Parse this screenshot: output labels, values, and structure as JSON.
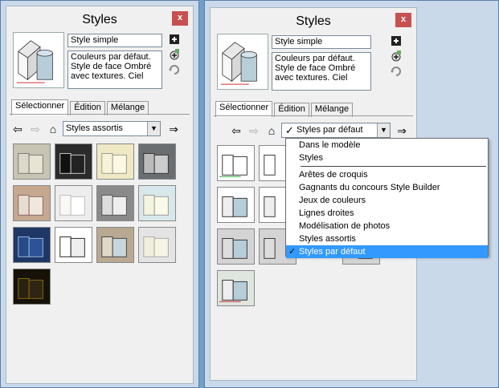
{
  "left_panel": {
    "title": "Styles",
    "close": "x",
    "style_name": "Style simple",
    "description": "Couleurs par défaut. Style de face Ombré avec textures. Ciel",
    "tabs": [
      "Sélectionner",
      "Édition",
      "Mélange"
    ],
    "collection": "Styles assortis"
  },
  "right_panel": {
    "title": "Styles",
    "close": "x",
    "style_name": "Style simple",
    "description": "Couleurs par défaut. Style de face Ombré avec textures. Ciel",
    "tabs": [
      "Sélectionner",
      "Édition",
      "Mélange"
    ],
    "collection": "Styles par défaut",
    "collection_check": "✓"
  },
  "dropdown_menu": {
    "group1": [
      "Dans le modèle",
      "Styles"
    ],
    "group2": [
      "Arêtes de croquis",
      "Gagnants du concours Style Builder",
      "Jeux de couleurs",
      "Lignes droites",
      "Modélisation de photos",
      "Styles assortis",
      "Styles par défaut"
    ],
    "selected": "Styles par défaut",
    "check": "✓"
  },
  "colors": {
    "accent": "#3399ff",
    "close_button": "#c75050"
  },
  "icons": {
    "back": "back-arrow-icon",
    "forward": "forward-arrow-icon",
    "home": "home-icon",
    "details": "details-icon",
    "create": "create-style-icon",
    "update": "update-style-icon"
  }
}
